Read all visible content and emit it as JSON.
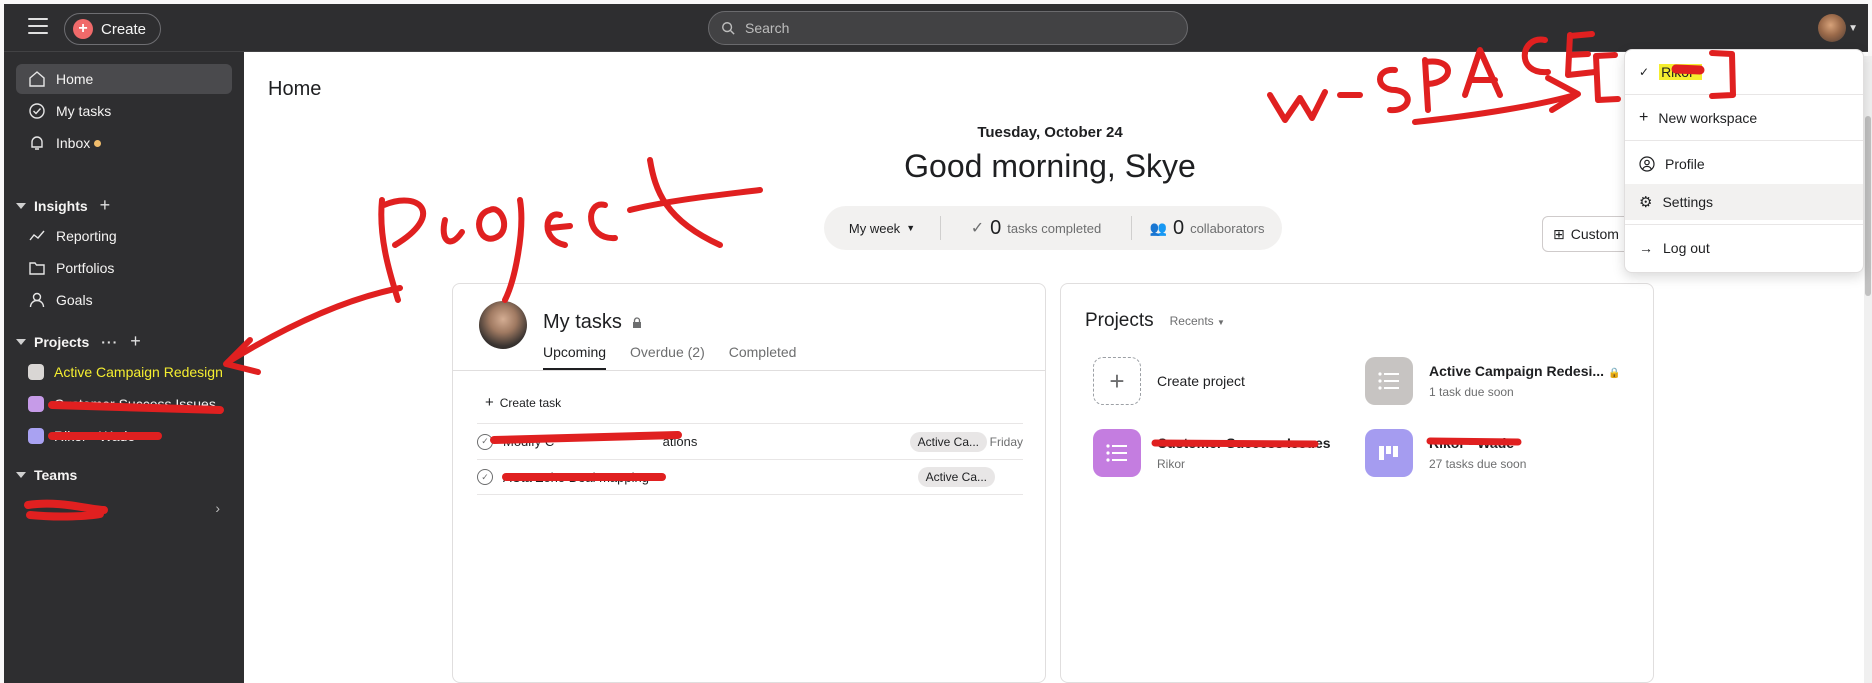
{
  "topbar": {
    "create_label": "Create",
    "search_placeholder": "Search"
  },
  "sidebar": {
    "nav": [
      {
        "label": "Home",
        "icon": "home-icon"
      },
      {
        "label": "My tasks",
        "icon": "check-circle-icon"
      },
      {
        "label": "Inbox",
        "icon": "bell-icon"
      }
    ],
    "insights_label": "Insights",
    "insights_items": [
      {
        "label": "Reporting",
        "icon": "trend-line-icon"
      },
      {
        "label": "Portfolios",
        "icon": "folder-icon"
      },
      {
        "label": "Goals",
        "icon": "person-icon"
      }
    ],
    "projects_label": "Projects",
    "projects": [
      {
        "label": "Active Campaign Redesign",
        "color": "#d9d6d4"
      },
      {
        "label": "Customer Success Issues",
        "color": "#c69be8"
      },
      {
        "label": "Rikor - Wade",
        "color": "#a9a2f2"
      }
    ],
    "teams_label": "Teams"
  },
  "main": {
    "page_title": "Home",
    "date": "Tuesday, October 24",
    "greeting": "Good morning, Skye",
    "stats": {
      "week_label": "My week",
      "tasks_count": "0",
      "tasks_label": "tasks completed",
      "collab_count": "0",
      "collab_label": "collaborators"
    },
    "custom_label": "Custom"
  },
  "my_tasks": {
    "title": "My tasks",
    "tabs": [
      "Upcoming",
      "Overdue (2)",
      "Completed"
    ],
    "create_task": "Create task",
    "rows": [
      {
        "text": "Modify C                              ations",
        "chip": "Active Ca...",
        "due": "Friday"
      },
      {
        "text": "ACta Zoho Deal mapping",
        "chip": "Active Ca...",
        "due": ""
      }
    ]
  },
  "projects_card": {
    "title": "Projects",
    "recents": "Recents",
    "create": "Create project",
    "items": [
      {
        "name": "Active Campaign Redesi...",
        "sub": "1 task due soon",
        "color": "#c7c4c2"
      },
      {
        "name": "Customer Success Issues",
        "sub": "Rikor",
        "color": "#c47de0"
      },
      {
        "name": "Rikor - Wade",
        "sub": "27 tasks due soon",
        "color": "#a59cf0"
      }
    ]
  },
  "dropdown": {
    "workspace": "Rikor",
    "items": [
      "New workspace",
      "Profile",
      "Settings",
      "Log out"
    ]
  },
  "annotations": {
    "project_word": "Project",
    "wspace_word": "W-SPACE"
  }
}
